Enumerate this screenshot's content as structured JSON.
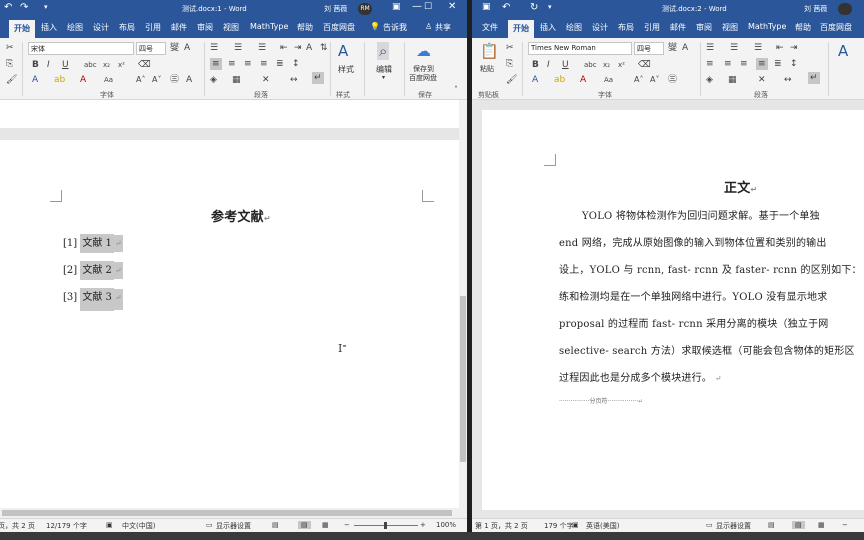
{
  "left": {
    "title": "测试.docx:1 - Word",
    "user": "刘 茜薇",
    "avatar_initials": "RM",
    "tabs": [
      "开始",
      "插入",
      "绘图",
      "设计",
      "布局",
      "引用",
      "邮件",
      "审阅",
      "视图",
      "MathType",
      "帮助",
      "百度网盘"
    ],
    "tell_me": "告诉我",
    "share": "共享",
    "font_name": "宋体",
    "font_size": "四号",
    "group_labels": {
      "font": "字体",
      "paragraph": "段落",
      "styles": "样式",
      "editing": "编辑",
      "save": "保存"
    },
    "styles_btn": "样式",
    "editing_btn": "编辑",
    "save_btn_line1": "保存到",
    "save_btn_line2": "百度网盘",
    "heading": "参考文献",
    "references": [
      {
        "num": "[1]",
        "text": "文献 1"
      },
      {
        "num": "[2]",
        "text": "文献 2"
      },
      {
        "num": "[3]",
        "text": "文献 3"
      }
    ],
    "status": {
      "pages": "页，共 2 页",
      "words": "12/179 个字",
      "lang": "中文(中国)",
      "display": "显示器设置",
      "zoom": "100%"
    }
  },
  "right": {
    "title": "测试.docx:2 - Word",
    "user": "刘 茜薇",
    "tabs": [
      "文件",
      "开始",
      "插入",
      "绘图",
      "设计",
      "布局",
      "引用",
      "邮件",
      "审阅",
      "视图",
      "MathType",
      "帮助",
      "百度网盘"
    ],
    "font_name": "Times New Roman",
    "font_size": "四号",
    "paste_label": "粘贴",
    "clipboard_label": "剪贴板",
    "group_labels": {
      "font": "字体",
      "paragraph": "段落"
    },
    "heading": "正文",
    "paragraph_lines": [
      "YOLO 将物体检测作为回归问题求解。基于一个单独",
      "end 网络，完成从原始图像的输入到物体位置和类别的输出",
      "设上，YOLO 与 rcnn, fast- rcnn 及 faster- rcnn 的区别如下：",
      "练和检测均是在一个单独网络中进行。YOLO 没有显示地求",
      "proposal  的过程而  fast- rcnn  采用分离的模块（独立于网",
      "selective- search 方法）求取候选框（可能会包含物体的矩形区",
      "过程因此也是分成多个模块进行。"
    ],
    "page_break": "分页符",
    "status": {
      "pages": "第 1 页，共 2 页",
      "words": "179 个字",
      "lang": "英语(美国)",
      "display": "显示器设置"
    }
  },
  "colors": {
    "accent": "#2b579a",
    "selection": "#c8c8c8"
  }
}
